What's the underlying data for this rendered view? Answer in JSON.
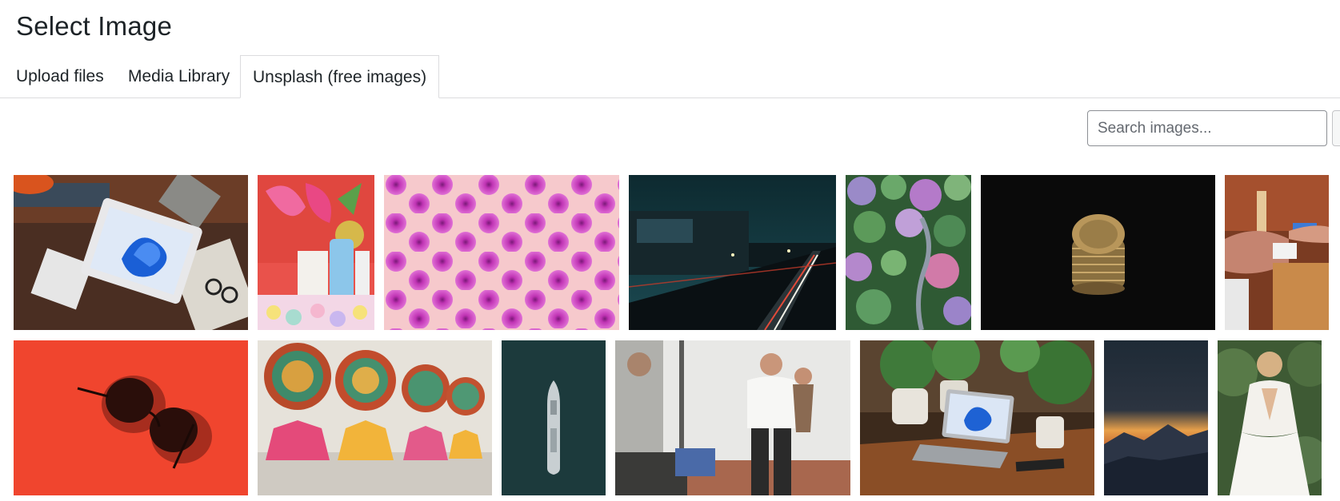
{
  "page": {
    "title": "Select Image"
  },
  "tabs": [
    {
      "label": "Upload files",
      "active": false
    },
    {
      "label": "Media Library",
      "active": false
    },
    {
      "label": "Unsplash (free images)",
      "active": true
    }
  ],
  "search": {
    "placeholder": "Search images...",
    "value": ""
  },
  "images": [
    {
      "row": 1,
      "subject": "tablet with blue swirl wallpaper on brown blanket with photos and sunglasses"
    },
    {
      "row": 1,
      "subject": "pink tropical flowers with cosmetic bottles and pastel pompoms"
    },
    {
      "row": 1,
      "subject": "pattern of magenta dahlias on pale pink background"
    },
    {
      "row": 1,
      "subject": "city highway at night with light trails"
    },
    {
      "row": 1,
      "subject": "aerial view of colorful hydrangea garden with path"
    },
    {
      "row": 1,
      "subject": "stack of gold coins on black background"
    },
    {
      "row": 1,
      "subject": "hand paying with card at cafe counter"
    },
    {
      "row": 2,
      "subject": "black round sunglasses on red background"
    },
    {
      "row": 2,
      "subject": "festival dancers in colorful feathered costumes"
    },
    {
      "row": 2,
      "subject": "aerial view of a ship on dark green sea"
    },
    {
      "row": 2,
      "subject": "man holding child looking out window with laptop"
    },
    {
      "row": 2,
      "subject": "laptop on wooden desk surrounded by potted plants"
    },
    {
      "row": 2,
      "subject": "orange sunset over dark mountains"
    },
    {
      "row": 2,
      "subject": "bride in white lace dress seen from behind"
    }
  ]
}
